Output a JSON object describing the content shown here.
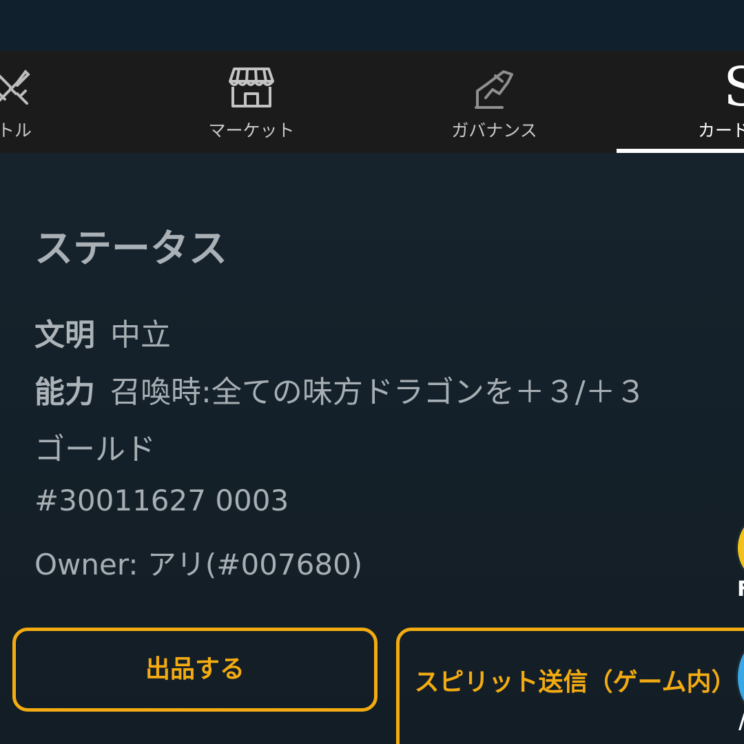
{
  "tabs": [
    {
      "id": "battle",
      "label": "トル",
      "icon": "crossed-swords-icon"
    },
    {
      "id": "market",
      "label": "マーケット",
      "icon": "storefront-icon"
    },
    {
      "id": "governance",
      "label": "ガバナンス",
      "icon": "hand-ballot-icon"
    },
    {
      "id": "cards",
      "label": "カード",
      "icon": "card-logo-icon",
      "active": true
    }
  ],
  "card_tab_glyph": "S",
  "status": {
    "title": "ステータス",
    "civilization_label": "文明",
    "civilization_value": "中立",
    "ability_label": "能力",
    "ability_value": "召喚時:全ての味方ドラゴンを＋３/＋３",
    "ability_value_cont": "ゴールド",
    "card_id": "#30011627 0003",
    "owner": "Owner: アリ(#007680)"
  },
  "buttons": {
    "list_label": "出品する",
    "send_label": "スピリット送信（ゲーム内）"
  },
  "side_badges": {
    "top_letter": "F",
    "bottom_letter": "/"
  },
  "colors": {
    "accent": "#f3ab12",
    "tab_bar": "#1b1b1b",
    "background": "#142129",
    "text": "#a7afb4"
  }
}
